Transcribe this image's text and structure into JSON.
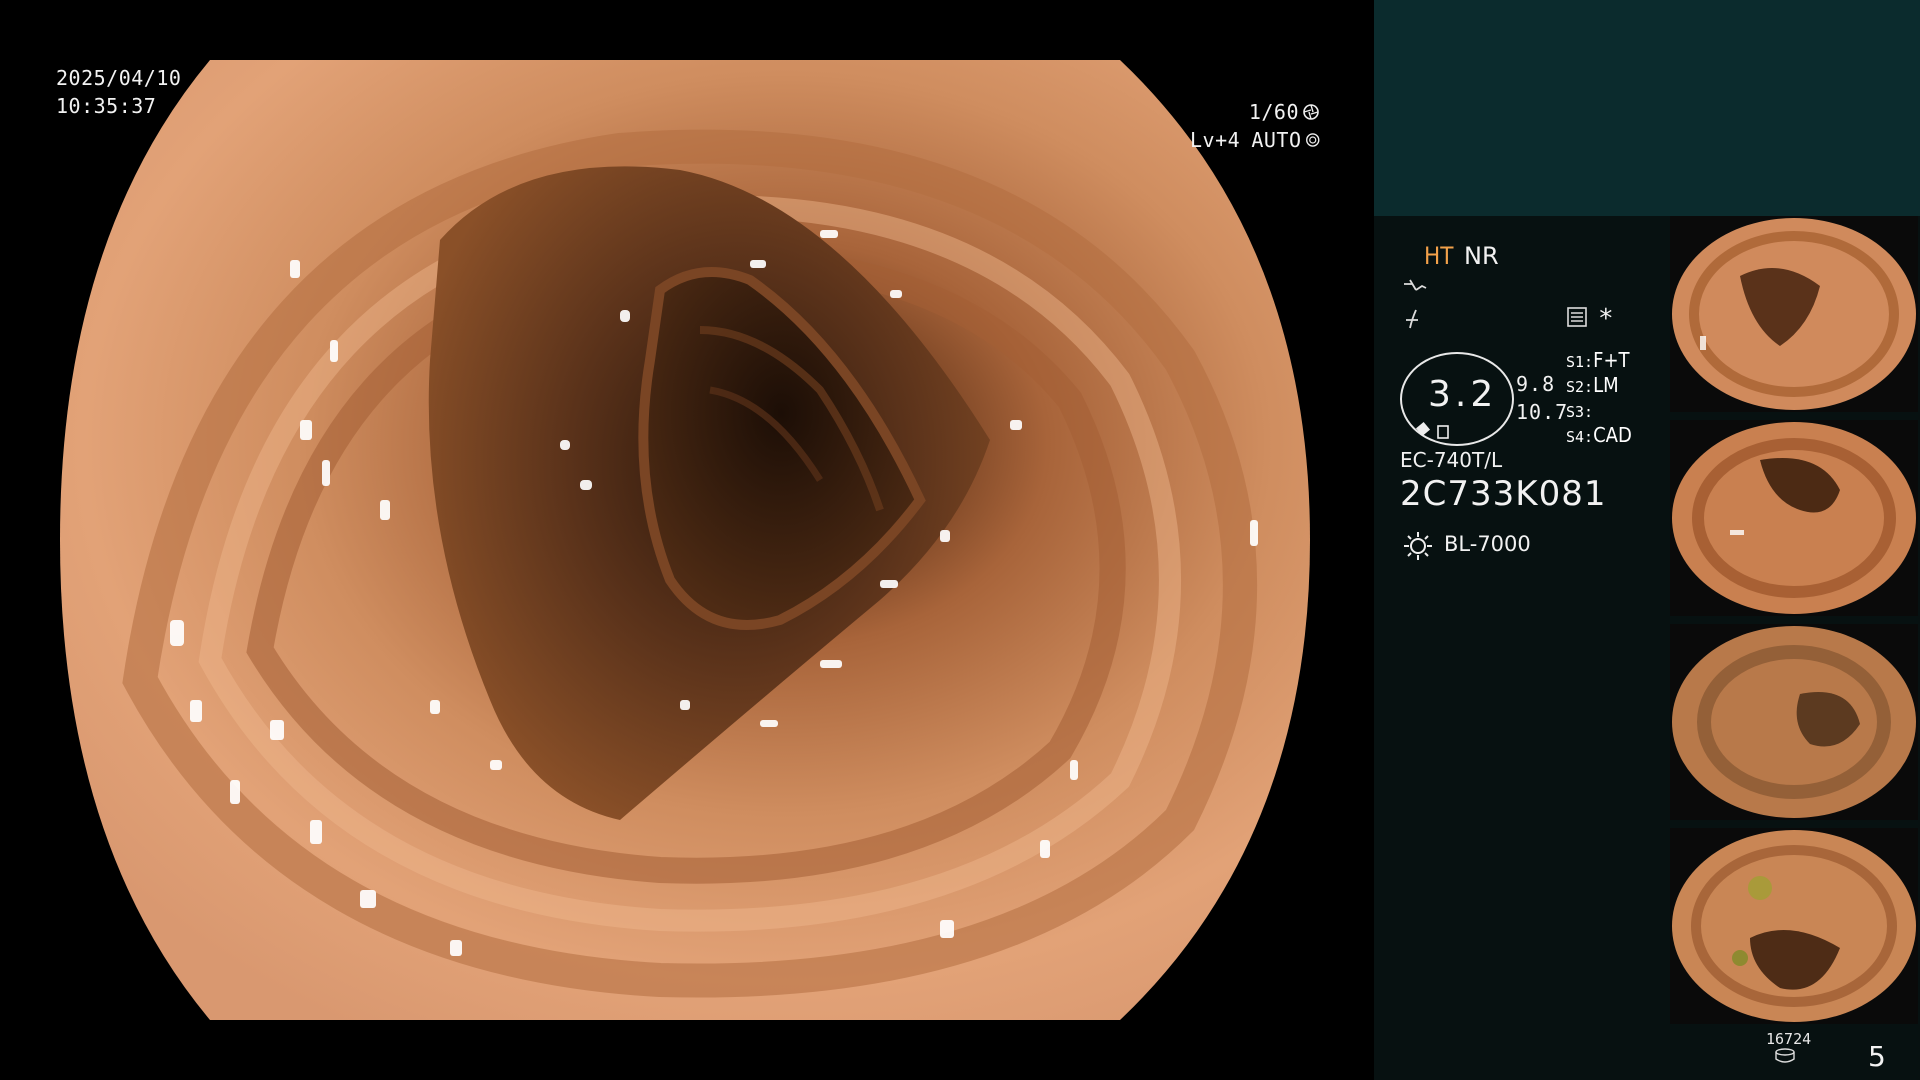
{
  "osd": {
    "date": "2025/04/10",
    "time": "10:35:37",
    "shutter": "1/60",
    "brightness": "Lv+4",
    "iris": "AUTO"
  },
  "panel": {
    "mode_ht": "HT",
    "mode_nr": "NR",
    "zoom_value": "3.2",
    "zoom_top": "9.8",
    "zoom_bottom": "10.7",
    "star": "*",
    "switches": [
      {
        "key": "S1:",
        "value": "F+T"
      },
      {
        "key": "S2:",
        "value": "LM"
      },
      {
        "key": "S3:",
        "value": ""
      },
      {
        "key": "S4:",
        "value": "CAD"
      }
    ],
    "scope_model": "EC-740T/L",
    "scope_serial": "2C733K081",
    "light_source": "BL-7000",
    "counter": "16724",
    "page_number": "5"
  },
  "icons": [
    "shutter-icon",
    "iris-icon",
    "enhance-icon",
    "color-icon",
    "memory-icon",
    "light-icon",
    "storage-icon"
  ],
  "colors": {
    "panel_bg": "#071111",
    "panel_top": "#0b2b2d",
    "ht_accent": "#f2a14a",
    "mucosa": "#c98656"
  }
}
